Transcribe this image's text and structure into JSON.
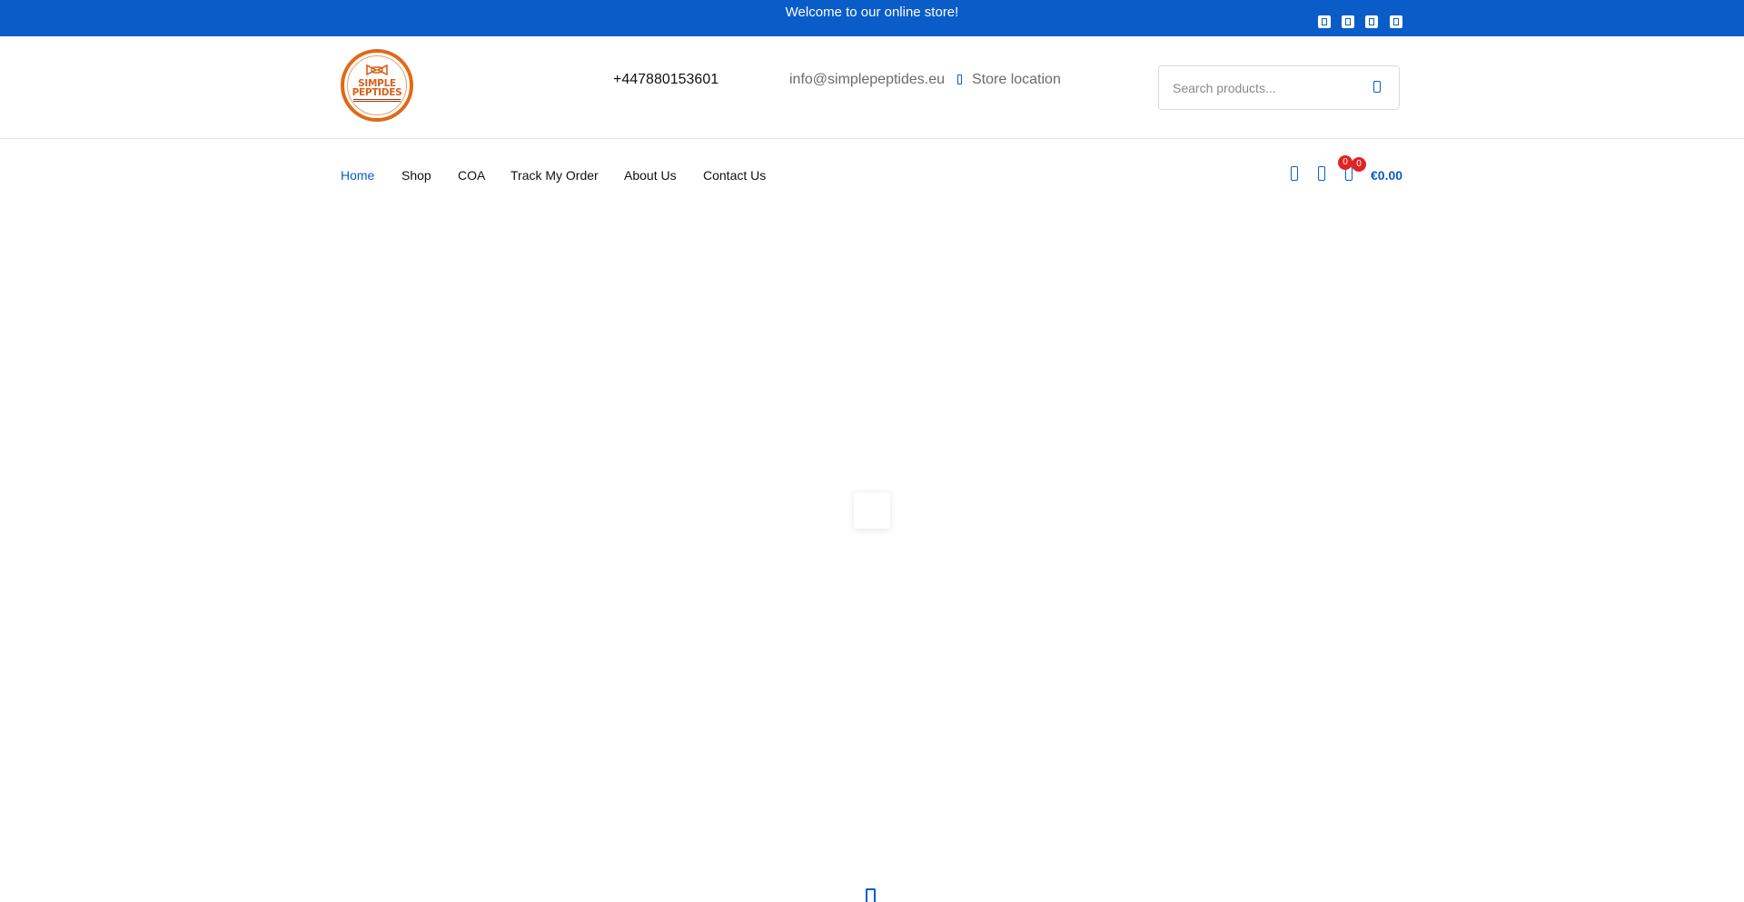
{
  "topbar": {
    "message": "Welcome to our online store!",
    "social_icons": [
      "facebook-icon",
      "twitter-icon",
      "instagram-icon",
      "youtube-icon"
    ]
  },
  "header": {
    "logo": {
      "line1": "SIMPLE",
      "line2": "PEPTIDES"
    },
    "phone": "+447880153601",
    "email": "info@simplepeptides.eu",
    "store_location": "Store location",
    "search_placeholder": "Search products..."
  },
  "nav": {
    "items": [
      {
        "label": "Home",
        "active": true
      },
      {
        "label": "Shop",
        "active": false
      },
      {
        "label": "COA",
        "active": false
      },
      {
        "label": "Track My Order",
        "active": false
      },
      {
        "label": "About Us",
        "active": false
      },
      {
        "label": "Contact Us",
        "active": false
      }
    ],
    "compare_count": "0",
    "cart_count": "0",
    "cart_total": "€0.00"
  },
  "colors": {
    "brand_blue": "#0a5cc8",
    "logo_orange": "#e06a17",
    "badge_red": "#e02424"
  }
}
